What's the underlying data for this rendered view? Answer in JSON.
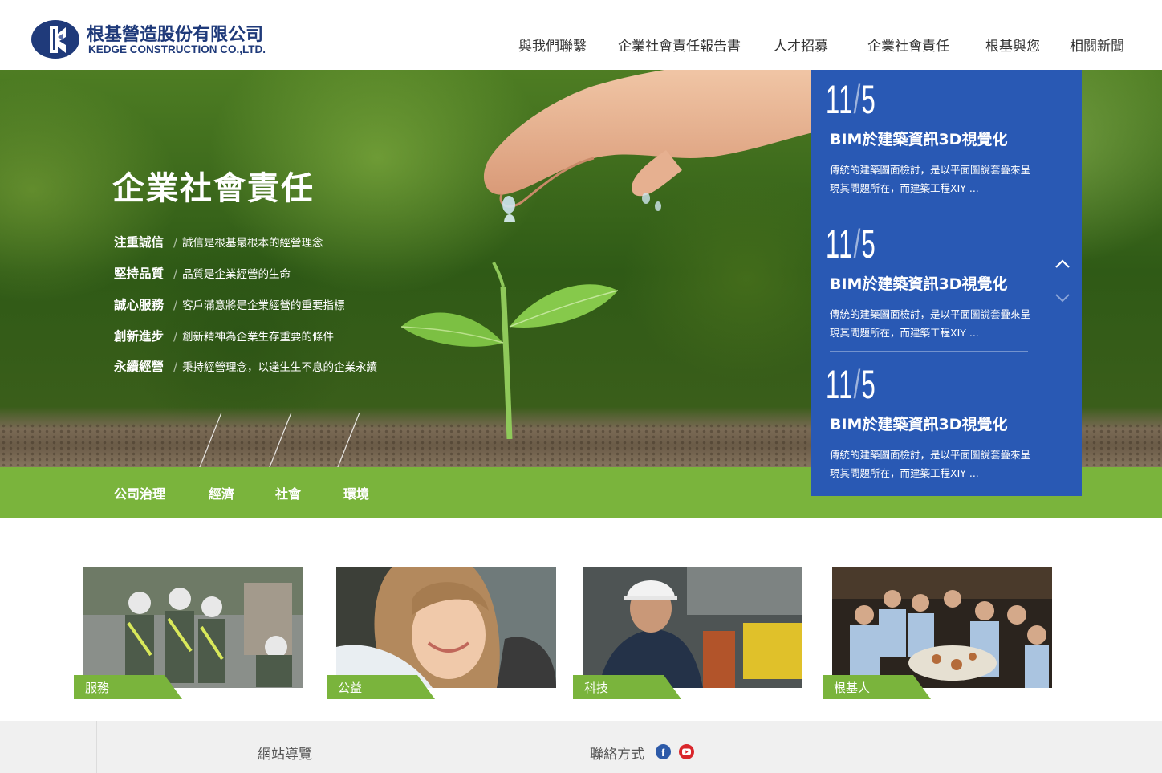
{
  "brand": {
    "name_cn": "根基營造股份有限公司",
    "name_en": "KEDGE CONSTRUCTION CO.,LTD.",
    "primary_color": "#1f3a7a",
    "accent_green": "#7ab43c",
    "news_blue": "#2959b4"
  },
  "nav": {
    "items": [
      {
        "label": "與我們聯繫"
      },
      {
        "label": "企業社會責任報告書"
      },
      {
        "label": "人才招募"
      },
      {
        "label": "企業社會責任"
      },
      {
        "label": "根基與您"
      },
      {
        "label": "相關新聞"
      }
    ]
  },
  "hero": {
    "title": "企業社會責任",
    "values": [
      {
        "key": "注重誠信",
        "text": "誠信是根基最根本的經營理念"
      },
      {
        "key": "堅持品質",
        "text": "品質是企業經營的生命"
      },
      {
        "key": "誠心服務",
        "text": "客戶滿意將是企業經營的重要指標"
      },
      {
        "key": "創新進步",
        "text": "創新精神為企業生存重要的條件"
      },
      {
        "key": "永續經營",
        "text": "秉持經營理念，以達生生不息的企業永續"
      }
    ],
    "tabs": [
      {
        "label": "公司治理"
      },
      {
        "label": "經濟"
      },
      {
        "label": "社會"
      },
      {
        "label": "環境"
      }
    ]
  },
  "news": {
    "items": [
      {
        "month": "11",
        "day": "5",
        "title": "BIM於建築資訊3D視覺化",
        "desc": "傳統的建築圖面檢討，是以平面圖說套疊來呈現其問題所在，而建築工程XIY ..."
      },
      {
        "month": "11",
        "day": "5",
        "title": "BIM於建築資訊3D視覺化",
        "desc": "傳統的建築圖面檢討，是以平面圖說套疊來呈現其問題所在，而建築工程XIY ..."
      },
      {
        "month": "11",
        "day": "5",
        "title": "BIM於建築資訊3D視覺化",
        "desc": "傳統的建築圖面檢討，是以平面圖說套疊來呈現其問題所在，而建築工程XIY ..."
      }
    ],
    "up_icon": "chevron-up-icon",
    "down_icon": "chevron-down-icon"
  },
  "cards": [
    {
      "label": "服務",
      "image": "workers-in-vests-photo"
    },
    {
      "label": "公益",
      "image": "smiling-woman-photo"
    },
    {
      "label": "科技",
      "image": "engineer-hardhat-photo"
    },
    {
      "label": "根基人",
      "image": "team-dinner-photo"
    }
  ],
  "footer": {
    "sitemap_label": "網站導覽",
    "contact_label": "聯絡方式",
    "social": [
      {
        "icon": "facebook-icon",
        "glyph": "f"
      },
      {
        "icon": "youtube-icon",
        "glyph": "▶"
      }
    ]
  }
}
